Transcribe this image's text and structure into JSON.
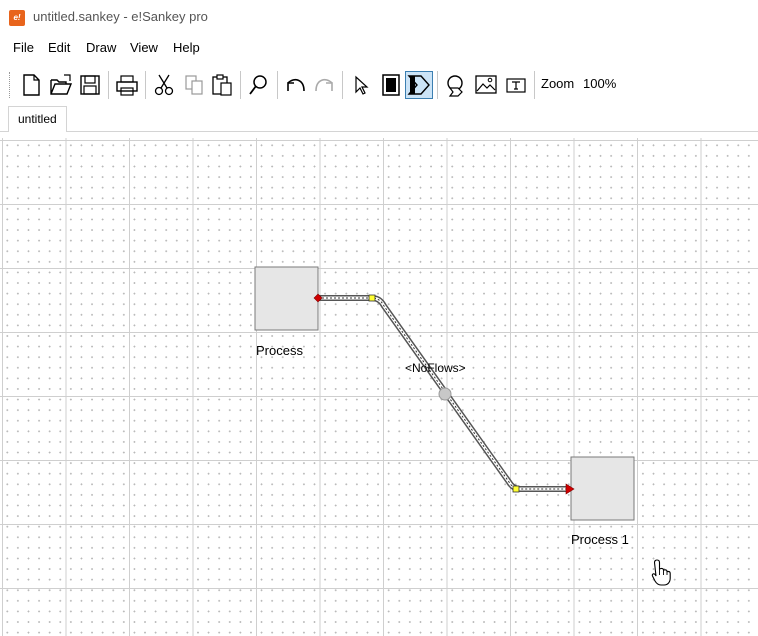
{
  "window": {
    "title": "untitled.sankey - e!Sankey pro",
    "app_icon_text": "e!"
  },
  "menu": [
    {
      "label": "File"
    },
    {
      "label": "Edit"
    },
    {
      "label": "Draw"
    },
    {
      "label": "View"
    },
    {
      "label": "Help"
    }
  ],
  "toolbar": {
    "buttons": [
      {
        "icon": "new-document-icon"
      },
      {
        "icon": "open-folder-icon"
      },
      {
        "icon": "save-icon"
      },
      {
        "icon": "print-icon"
      },
      {
        "icon": "cut-icon"
      },
      {
        "icon": "copy-icon"
      },
      {
        "icon": "paste-icon"
      },
      {
        "icon": "search-icon"
      },
      {
        "icon": "undo-icon"
      },
      {
        "icon": "redo-icon"
      },
      {
        "icon": "pointer-icon"
      },
      {
        "icon": "process-node-icon"
      },
      {
        "icon": "flow-arrow-icon",
        "active": true
      },
      {
        "icon": "entry-exit-icon"
      },
      {
        "icon": "image-icon"
      },
      {
        "icon": "text-box-icon"
      }
    ],
    "zoom_label": "Zoom",
    "zoom_value": "100%"
  },
  "tabs": [
    {
      "label": "untitled"
    }
  ],
  "diagram": {
    "processes": [
      {
        "label": "Process"
      },
      {
        "label": "Process 1"
      }
    ],
    "flows": [
      {
        "label": "<NoFlows>"
      }
    ]
  },
  "colors": {
    "process_fill": "#e6e6e6",
    "process_border": "#7a7a7a",
    "handle_red": "#d00000",
    "handle_yellow": "#ffff33",
    "active_tool_bg": "#cce4f7"
  }
}
